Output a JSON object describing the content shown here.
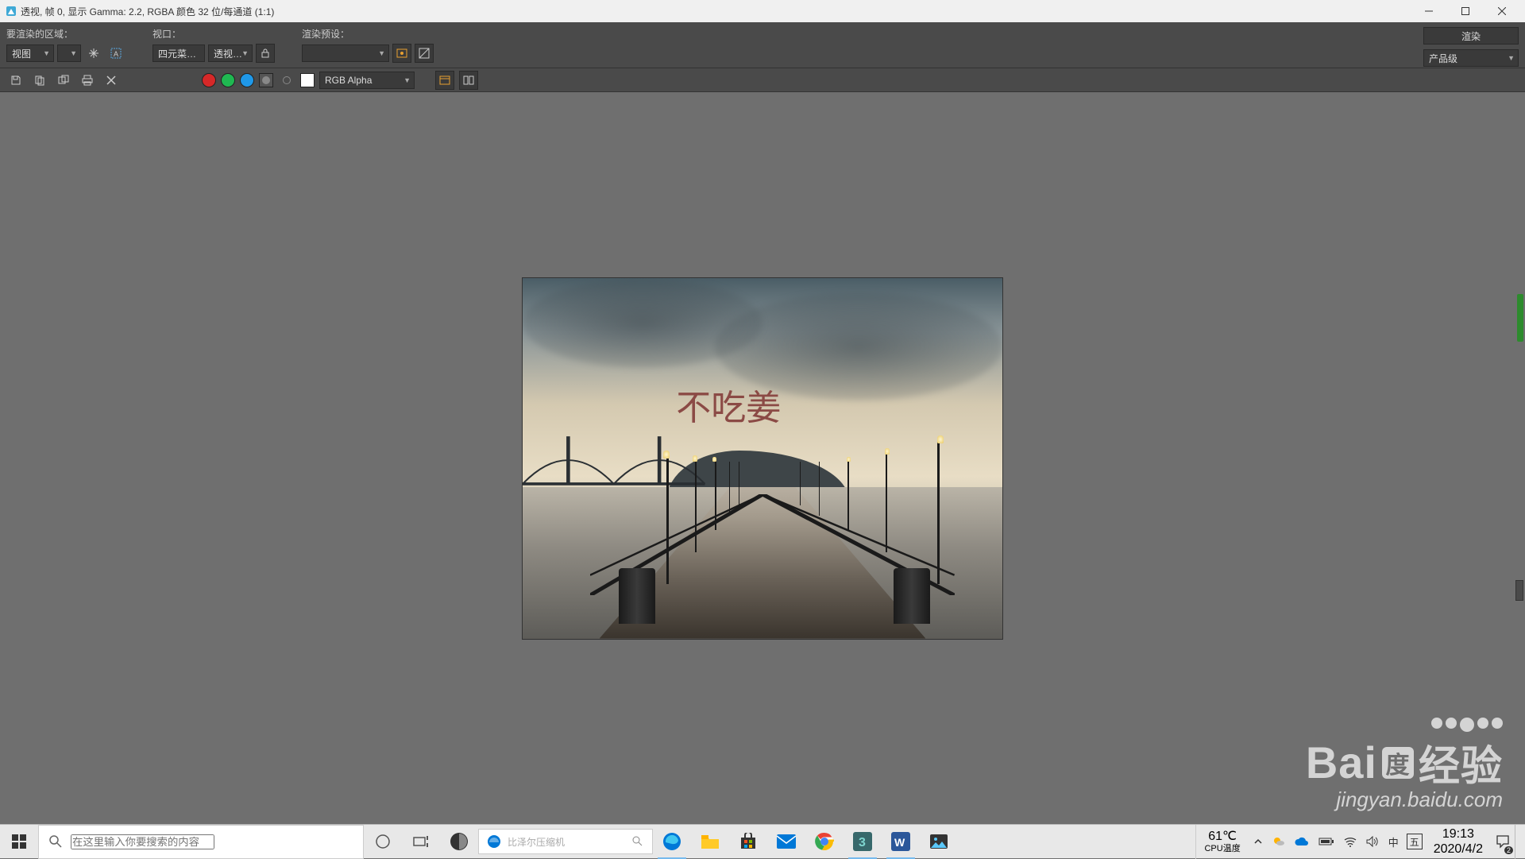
{
  "window": {
    "title": "透视, 帧 0, 显示 Gamma: 2.2, RGBA 颜色 32 位/每通道 (1:1)"
  },
  "toolbar": {
    "region_label": "要渲染的区域：",
    "viewport_label": "视口：",
    "preset_label": "渲染预设：",
    "region_value": "视图",
    "viewport_value1": "四元菜…",
    "viewport_value2": "透视…",
    "preset_value": "",
    "render_btn": "渲染",
    "quality_value": "产品级",
    "channel_value": "RGB Alpha"
  },
  "colors": {
    "red": "#d62828",
    "green": "#1fb851",
    "blue": "#1f98e8",
    "white": "#ffffff"
  },
  "rendered": {
    "overlay_text": "不吃姜"
  },
  "watermark": {
    "brand": "Baidu 经验",
    "url": "jingyan.baidu.com"
  },
  "taskbar": {
    "search_placeholder": "在这里输入你要搜索的内容",
    "browser_tab_text": "比泽尔压缩机",
    "temp_value": "61℃",
    "temp_label": "CPU温度",
    "ime": "中",
    "ime2": "五",
    "time": "19:13",
    "date": "2020/4/2"
  }
}
